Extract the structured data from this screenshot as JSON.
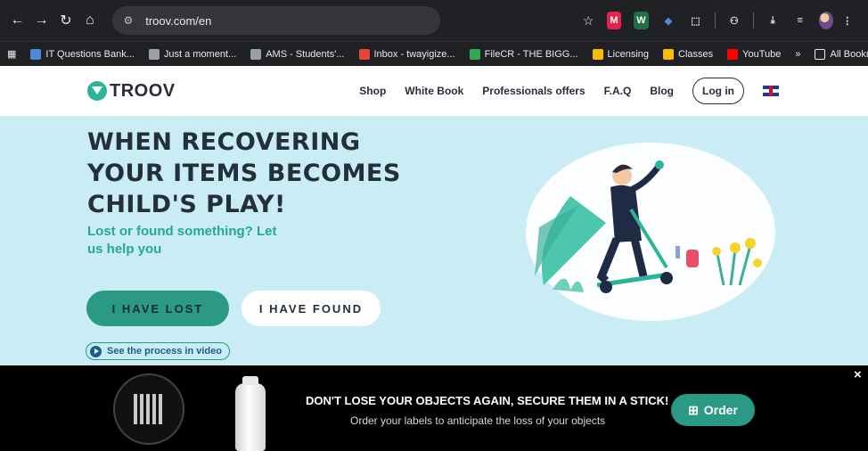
{
  "browser": {
    "url": "troov.com/en",
    "bookmarks": [
      {
        "label": "IT Questions Bank...",
        "color": "#4a8ad8"
      },
      {
        "label": "Just a moment...",
        "color": "#9aa0a6"
      },
      {
        "label": "AMS - Students'...",
        "color": "#9aa0a6"
      },
      {
        "label": "Inbox - twayigize...",
        "color": "#ea4335"
      },
      {
        "label": "FileCR - THE BIGG...",
        "color": "#34a853"
      },
      {
        "label": "Licensing",
        "color": "#fbbc04"
      },
      {
        "label": "Classes",
        "color": "#fbbc04"
      },
      {
        "label": "YouTube",
        "color": "#ff0000"
      }
    ],
    "more_bookmarks": "»",
    "all_bookmarks": "All Bookmarks"
  },
  "header": {
    "logo_text": "TROOV",
    "menu": [
      "Shop",
      "White Book",
      "Professionals offers",
      "F.A.Q",
      "Blog"
    ],
    "login": "Log in",
    "language_icon": "uk-flag-icon"
  },
  "hero": {
    "headline": "WHEN RECOVERING YOUR ITEMS BECOMES CHILD'S PLAY!",
    "subhead": "Lost or found something? Let us help you",
    "lost_button": "I HAVE LOST",
    "found_button": "I HAVE FOUND",
    "video_link": "See the process in video"
  },
  "promo": {
    "title": "DON'T LOSE YOUR OBJECTS AGAIN, SECURE THEM IN A STICK!",
    "subtitle": "Order your labels to anticipate the loss of your objects",
    "order_button": "Order",
    "order_icon": "gift-icon",
    "close_label": "×"
  },
  "colors": {
    "accent": "#2a9a84",
    "hero_bg": "#c9ecf5",
    "headline": "#23303a"
  }
}
